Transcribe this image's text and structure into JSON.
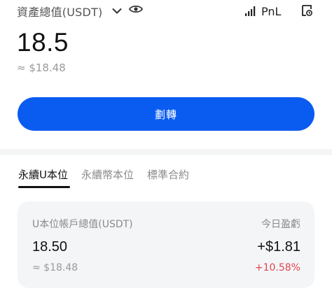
{
  "header": {
    "asset_label": "資產總值(USDT)",
    "pnl_label": "PnL",
    "icons": {
      "dropdown": "chevron-down-icon",
      "visibility": "eye-icon",
      "pnl": "signal-bars-icon",
      "history": "history-icon"
    }
  },
  "balance": {
    "total": "18.5",
    "usd_equivalent": "≈ $18.48"
  },
  "actions": {
    "transfer_label": "劃轉",
    "accent_color": "#0a5cf0"
  },
  "tabs": [
    {
      "label": "永續U本位",
      "active": true
    },
    {
      "label": "永續幣本位",
      "active": false
    },
    {
      "label": "標準合約",
      "active": false
    }
  ],
  "account": {
    "title": "U本位帳戶總值(USDT)",
    "value": "18.50",
    "usd_equivalent": "≈ $18.48",
    "pnl_title": "今日盈虧",
    "pnl_value": "+$1.81",
    "pnl_percent": "+10.58%",
    "pnl_percent_color": "#e0464e"
  }
}
